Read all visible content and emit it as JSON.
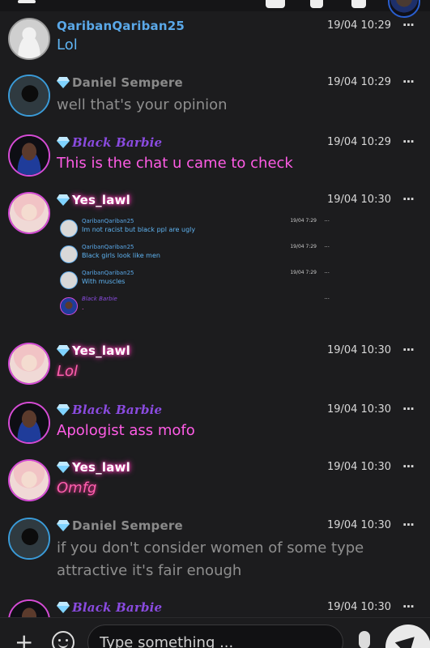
{
  "input": {
    "placeholder": "Type something ..."
  },
  "messages": [
    {
      "user": "QaribanQariban25",
      "time": "19/04 10:29",
      "text": "Lol"
    },
    {
      "user": "Daniel Sempere",
      "time": "19/04 10:29",
      "text": "well that's your opinion"
    },
    {
      "user": "Black Barbie",
      "time": "19/04 10:29",
      "text": "This is the chat u came to check"
    },
    {
      "user": "Yes_lawl",
      "time": "19/04 10:30",
      "embed": [
        {
          "user": "QaribanQariban25",
          "time": "19/04 7:29",
          "text": "Im not racist but black ppl are ugly"
        },
        {
          "user": "QaribanQariban25",
          "time": "19/04 7:29",
          "text": "Black girls look like men"
        },
        {
          "user": "QaribanQariban25",
          "time": "19/04 7:29",
          "text": "With muscles"
        },
        {
          "user": "Black Barbie",
          "time": "",
          "text": "."
        }
      ]
    },
    {
      "user": "Yes_lawl",
      "time": "19/04 10:30",
      "text": "Lol"
    },
    {
      "user": "Black Barbie",
      "time": "19/04 10:30",
      "text": "Apologist ass mofo"
    },
    {
      "user": "Yes_lawl",
      "time": "19/04 10:30",
      "text": "Omfg"
    },
    {
      "user": "Daniel Sempere",
      "time": "19/04 10:30",
      "text": "if you don't consider women of some type attractive it's fair enough"
    },
    {
      "user": "Black Barbie",
      "time": "19/04 10:30",
      "text": ""
    }
  ]
}
